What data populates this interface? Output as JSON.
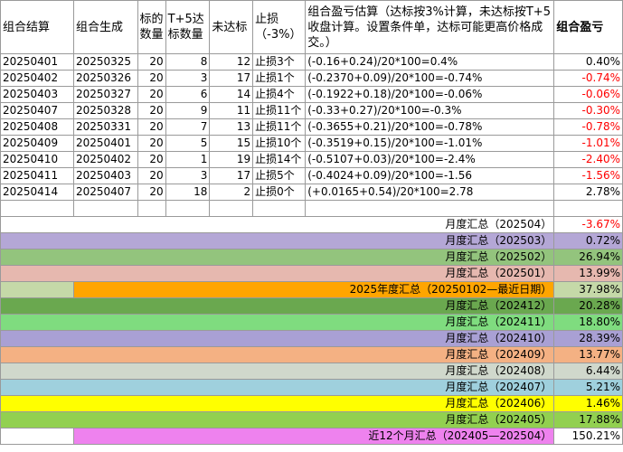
{
  "headers": {
    "h1": "组合结算",
    "h2": "组合生成",
    "h3": "标的数量",
    "h4": "T+5达标数量",
    "h5": "未达标",
    "h6": "止损（-3%）",
    "h7": "组合盈亏估算（达标按3%计算，未达标按T+5收盘计算。设置条件单，达标可能更高价格成交。）",
    "h8": "组合盈亏"
  },
  "rows": [
    {
      "settle": "20250401",
      "gen": "20250325",
      "count": "20",
      "hit": "8",
      "miss": "12",
      "stop": "止损3个",
      "formula": "(-0.16+0.24)/20*100=0.4%",
      "pnl": "0.40%",
      "neg": false
    },
    {
      "settle": "20250402",
      "gen": "20250326",
      "count": "20",
      "hit": "3",
      "miss": "17",
      "stop": "止损1个",
      "formula": "(-0.2370+0.09)/20*100=-0.74%",
      "pnl": "-0.74%",
      "neg": true
    },
    {
      "settle": "20250403",
      "gen": "20250327",
      "count": "20",
      "hit": "6",
      "miss": "14",
      "stop": "止损4个",
      "formula": "(-0.1922+0.18)/20*100=-0.06%",
      "pnl": "-0.06%",
      "neg": true
    },
    {
      "settle": "20250407",
      "gen": "20250328",
      "count": "20",
      "hit": "9",
      "miss": "11",
      "stop": "止损11个",
      "formula": "(-0.33+0.27)/20*100=-0.3%",
      "pnl": "-0.30%",
      "neg": true
    },
    {
      "settle": "20250408",
      "gen": "20250331",
      "count": "20",
      "hit": "7",
      "miss": "13",
      "stop": "止损11个",
      "formula": "(-0.3655+0.21)/20*100=-0.78%",
      "pnl": "-0.78%",
      "neg": true
    },
    {
      "settle": "20250409",
      "gen": "20250401",
      "count": "20",
      "hit": "5",
      "miss": "15",
      "stop": "止损10个",
      "formula": "(-0.3519+0.15)/20*100=-1.01%",
      "pnl": "-1.01%",
      "neg": true
    },
    {
      "settle": "20250410",
      "gen": "20250402",
      "count": "20",
      "hit": "1",
      "miss": "19",
      "stop": "止损14个",
      "formula": "(-0.5107+0.03)/20*100=-2.4%",
      "pnl": "-2.40%",
      "neg": true
    },
    {
      "settle": "20250411",
      "gen": "20250403",
      "count": "20",
      "hit": "3",
      "miss": "17",
      "stop": "止损5个",
      "formula": "(-0.4024+0.09)/20*100=-1.56",
      "pnl": "-1.56%",
      "neg": true
    },
    {
      "settle": "20250414",
      "gen": "20250407",
      "count": "20",
      "hit": "18",
      "miss": "2",
      "stop": "止损0个",
      "formula": "(+0.0165+0.54)/20*100=2.78",
      "pnl": "2.78%",
      "neg": false
    }
  ],
  "summaries": [
    {
      "label": "月度汇总（202504）",
      "value": "-3.67%",
      "bg": "#ffffff",
      "labelBg": "#ffffff",
      "neg": true
    },
    {
      "label": "月度汇总（202503）",
      "value": "0.72%",
      "bg": "#b4a7d6",
      "labelBg": "#b4a7d6",
      "neg": false
    },
    {
      "label": "月度汇总（202502）",
      "value": "26.94%",
      "bg": "#93c47d",
      "labelBg": "#93c47d",
      "neg": false
    },
    {
      "label": "月度汇总（202501）",
      "value": "13.99%",
      "bg": "#e6b8af",
      "labelBg": "#e6b8af",
      "neg": false
    },
    {
      "label": "2025年度汇总（20250102—最近日期）",
      "value": "37.98%",
      "bg": "#c5d9a8",
      "labelBg": "#ffa500",
      "neg": false,
      "wide": true
    },
    {
      "label": "月度汇总（202412）",
      "value": "20.28%",
      "bg": "#6aa84f",
      "labelBg": "#6aa84f",
      "neg": false
    },
    {
      "label": "月度汇总（202411）",
      "value": "18.80%",
      "bg": "#7fdc7f",
      "labelBg": "#7fdc7f",
      "neg": false
    },
    {
      "label": "月度汇总（202410）",
      "value": "28.39%",
      "bg": "#a9a0d4",
      "labelBg": "#a9a0d4",
      "neg": false
    },
    {
      "label": "月度汇总（202409）",
      "value": "13.77%",
      "bg": "#f4b183",
      "labelBg": "#f4b183",
      "neg": false
    },
    {
      "label": "月度汇总（202408）",
      "value": "6.44%",
      "bg": "#d0d8cc",
      "labelBg": "#d0d8cc",
      "neg": false
    },
    {
      "label": "月度汇总（202407）",
      "value": "5.21%",
      "bg": "#9fd0dd",
      "labelBg": "#9fd0dd",
      "neg": false
    },
    {
      "label": "月度汇总（202406）",
      "value": "1.46%",
      "bg": "#ffff00",
      "labelBg": "#ffff00",
      "neg": false
    },
    {
      "label": "月度汇总（202405）",
      "value": "17.88%",
      "bg": "#92d050",
      "labelBg": "#92d050",
      "neg": false
    },
    {
      "label": "近12个月汇总（202405—202504）",
      "value": "150.21%",
      "bg": "#ffffff",
      "labelBg": "#ee82ee",
      "neg": false,
      "wide": true
    }
  ],
  "colors": {
    "negative": "#ff0000",
    "border": "#9a9a9a"
  }
}
